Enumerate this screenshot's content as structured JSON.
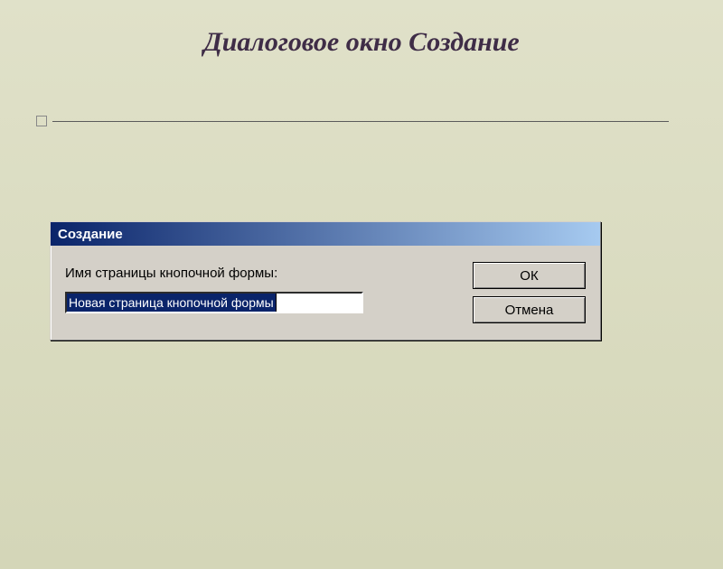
{
  "slide": {
    "title": "Диалоговое окно Создание"
  },
  "dialog": {
    "title": "Создание",
    "field_label": "Имя страницы кнопочной формы:",
    "input_value": "Новая страница кнопочной формы",
    "buttons": {
      "ok": "ОК",
      "cancel": "Отмена"
    }
  }
}
